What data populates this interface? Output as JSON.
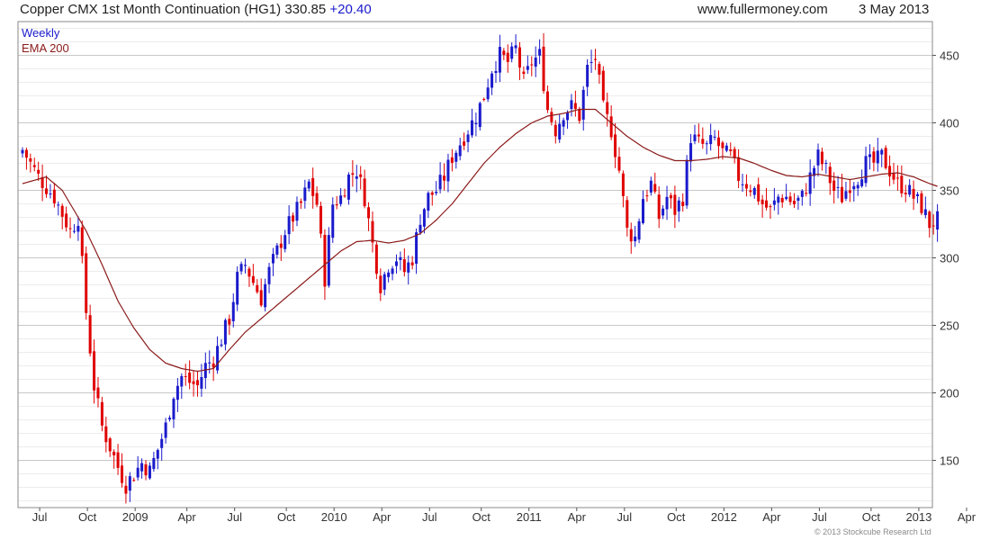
{
  "header": {
    "instrument": "Copper CMX 1st Month Continuation (HG1)",
    "last": "330.85",
    "change": "+20.40",
    "site": "www.fullermoney.com",
    "date": "3 May 2013"
  },
  "copyright": "© 2013 Stockcube Research Ltd",
  "colors": {
    "up": "#1a1acc",
    "down": "#e00000",
    "ema": "#8b1a1a",
    "grid_major": "#c8c8c8",
    "grid_minor": "#ececec"
  },
  "chart_data": {
    "type": "candlestick",
    "legend": [
      {
        "label": "Weekly",
        "color": "#1a1acc"
      },
      {
        "label": "EMA 200",
        "color": "#8b1a1a"
      }
    ],
    "legend_position": "top-left",
    "grid": true,
    "ylim": [
      115,
      475
    ],
    "y_axis_side": "right",
    "yticks": [
      "150",
      "200",
      "250",
      "300",
      "350",
      "400",
      "450"
    ],
    "xticks": [
      "Jul",
      "Oct",
      "2009",
      "Apr",
      "Jul",
      "Oct",
      "2010",
      "Apr",
      "Jul",
      "Oct",
      "2011",
      "Apr",
      "Jul",
      "Oct",
      "2012",
      "Apr",
      "Jul",
      "Oct",
      "2013",
      "Apr"
    ],
    "close_anchors": [
      [
        0,
        380
      ],
      [
        4,
        360
      ],
      [
        8,
        345
      ],
      [
        12,
        320
      ],
      [
        14,
        330
      ],
      [
        16,
        260
      ],
      [
        18,
        205
      ],
      [
        20,
        175
      ],
      [
        22,
        160
      ],
      [
        24,
        145
      ],
      [
        26,
        132
      ],
      [
        28,
        140
      ],
      [
        30,
        148
      ],
      [
        32,
        142
      ],
      [
        34,
        158
      ],
      [
        36,
        175
      ],
      [
        38,
        200
      ],
      [
        40,
        212
      ],
      [
        42,
        208
      ],
      [
        44,
        205
      ],
      [
        46,
        220
      ],
      [
        48,
        225
      ],
      [
        50,
        240
      ],
      [
        52,
        255
      ],
      [
        54,
        285
      ],
      [
        56,
        295
      ],
      [
        58,
        282
      ],
      [
        60,
        270
      ],
      [
        62,
        290
      ],
      [
        64,
        305
      ],
      [
        66,
        320
      ],
      [
        68,
        330
      ],
      [
        70,
        340
      ],
      [
        72,
        355
      ],
      [
        74,
        340
      ],
      [
        76,
        285
      ],
      [
        78,
        340
      ],
      [
        80,
        345
      ],
      [
        82,
        360
      ],
      [
        84,
        365
      ],
      [
        86,
        345
      ],
      [
        88,
        310
      ],
      [
        90,
        280
      ],
      [
        92,
        295
      ],
      [
        94,
        300
      ],
      [
        96,
        290
      ],
      [
        98,
        300
      ],
      [
        100,
        330
      ],
      [
        102,
        345
      ],
      [
        104,
        350
      ],
      [
        106,
        360
      ],
      [
        108,
        375
      ],
      [
        110,
        385
      ],
      [
        112,
        395
      ],
      [
        114,
        405
      ],
      [
        116,
        420
      ],
      [
        118,
        440
      ],
      [
        120,
        450
      ],
      [
        122,
        445
      ],
      [
        124,
        455
      ],
      [
        126,
        430
      ],
      [
        128,
        445
      ],
      [
        130,
        450
      ],
      [
        132,
        410
      ],
      [
        134,
        395
      ],
      [
        136,
        408
      ],
      [
        138,
        412
      ],
      [
        140,
        405
      ],
      [
        142,
        440
      ],
      [
        144,
        448
      ],
      [
        146,
        410
      ],
      [
        148,
        395
      ],
      [
        150,
        365
      ],
      [
        152,
        320
      ],
      [
        154,
        315
      ],
      [
        156,
        345
      ],
      [
        158,
        355
      ],
      [
        160,
        330
      ],
      [
        162,
        345
      ],
      [
        164,
        335
      ],
      [
        166,
        345
      ],
      [
        168,
        390
      ],
      [
        170,
        385
      ],
      [
        172,
        382
      ],
      [
        174,
        388
      ],
      [
        176,
        378
      ],
      [
        178,
        375
      ],
      [
        180,
        360
      ],
      [
        182,
        355
      ],
      [
        184,
        350
      ],
      [
        186,
        340
      ],
      [
        188,
        335
      ],
      [
        190,
        345
      ],
      [
        192,
        345
      ],
      [
        194,
        340
      ],
      [
        196,
        345
      ],
      [
        198,
        360
      ],
      [
        200,
        375
      ],
      [
        202,
        365
      ],
      [
        204,
        350
      ],
      [
        206,
        345
      ],
      [
        208,
        355
      ],
      [
        210,
        360
      ],
      [
        212,
        370
      ],
      [
        214,
        370
      ],
      [
        216,
        375
      ],
      [
        218,
        365
      ],
      [
        220,
        355
      ],
      [
        222,
        352
      ],
      [
        224,
        345
      ],
      [
        226,
        338
      ],
      [
        228,
        325
      ],
      [
        230,
        328
      ]
    ],
    "ema_anchors": [
      [
        0,
        355
      ],
      [
        6,
        360
      ],
      [
        10,
        350
      ],
      [
        16,
        320
      ],
      [
        20,
        295
      ],
      [
        24,
        268
      ],
      [
        28,
        248
      ],
      [
        32,
        232
      ],
      [
        36,
        222
      ],
      [
        40,
        218
      ],
      [
        44,
        216
      ],
      [
        48,
        218
      ],
      [
        52,
        232
      ],
      [
        56,
        245
      ],
      [
        60,
        255
      ],
      [
        66,
        270
      ],
      [
        72,
        285
      ],
      [
        76,
        295
      ],
      [
        80,
        305
      ],
      [
        84,
        312
      ],
      [
        88,
        313
      ],
      [
        92,
        311
      ],
      [
        96,
        313
      ],
      [
        100,
        318
      ],
      [
        104,
        328
      ],
      [
        108,
        340
      ],
      [
        112,
        355
      ],
      [
        116,
        370
      ],
      [
        120,
        382
      ],
      [
        124,
        392
      ],
      [
        128,
        400
      ],
      [
        132,
        405
      ],
      [
        136,
        407
      ],
      [
        140,
        410
      ],
      [
        144,
        410
      ],
      [
        148,
        400
      ],
      [
        152,
        390
      ],
      [
        156,
        382
      ],
      [
        160,
        376
      ],
      [
        164,
        372
      ],
      [
        168,
        372
      ],
      [
        172,
        373
      ],
      [
        176,
        375
      ],
      [
        180,
        374
      ],
      [
        184,
        370
      ],
      [
        188,
        365
      ],
      [
        192,
        361
      ],
      [
        196,
        360
      ],
      [
        200,
        362
      ],
      [
        204,
        360
      ],
      [
        208,
        358
      ],
      [
        212,
        360
      ],
      [
        216,
        362
      ],
      [
        220,
        363
      ],
      [
        224,
        360
      ],
      [
        228,
        355
      ],
      [
        230,
        353
      ]
    ]
  }
}
